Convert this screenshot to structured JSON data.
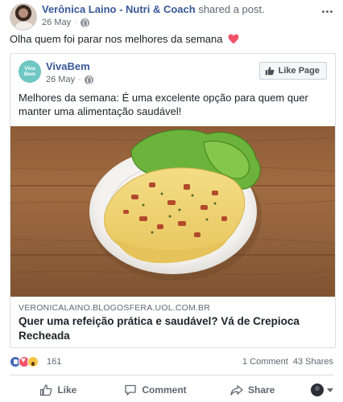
{
  "post": {
    "author": "Verônica Laino - Nutri & Coach",
    "shared_text": "shared a post.",
    "date": "26 May",
    "text": "Olha quem foi parar nos melhores da semana"
  },
  "shared": {
    "page_logo_text": "Viva Bem",
    "page_name": "VivaBem",
    "date": "26 May",
    "like_page_label": "Like Page",
    "text": "Melhores da semana: É uma excelente opção para quem quer manter uma alimentação saudável!",
    "link_domain": "VERONICALAINO.BLOGOSFERA.UOL.COM.BR",
    "link_title": "Quer uma refeição prática e saudável? Vá de Crepioca Recheada"
  },
  "reactions": {
    "count": "161",
    "comments": "1 Comment",
    "shares": "43 Shares"
  },
  "actions": {
    "like": "Like",
    "comment": "Comment",
    "share": "Share"
  },
  "colors": {
    "link_blue": "#385898",
    "text": "#1d2129",
    "muted": "#606770",
    "heart": "#f25268",
    "like_blue": "#4267b2"
  },
  "icons": [
    "globe-icon",
    "heart-icon",
    "more-icon",
    "thumbs-up-icon",
    "comment-icon",
    "share-icon",
    "caret-down-icon"
  ]
}
